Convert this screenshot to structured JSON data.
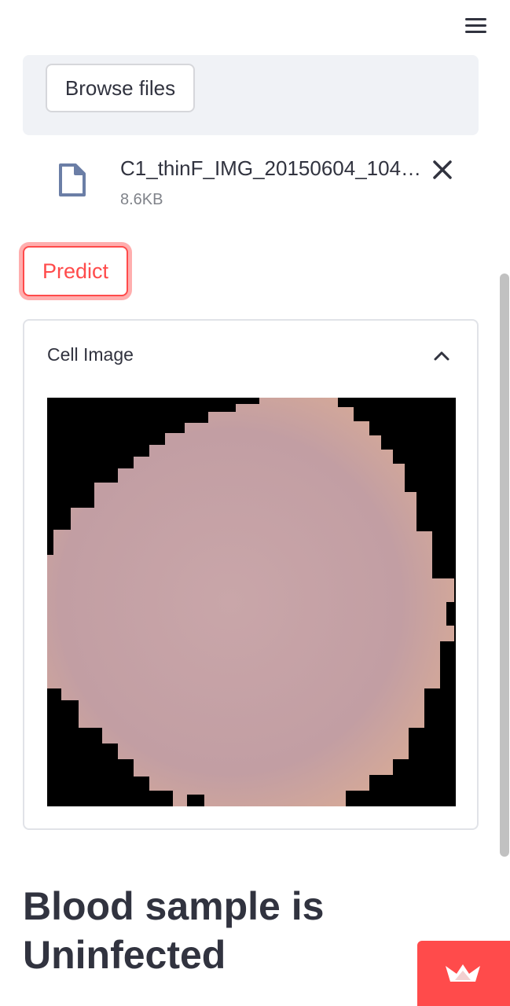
{
  "header": {
    "menu_icon": "hamburger-menu-icon"
  },
  "uploader": {
    "browse_label": "Browse files",
    "file": {
      "icon": "file-icon",
      "name": "C1_thinF_IMG_20150604_104…",
      "size": "8.6KB",
      "delete_icon": "close-icon"
    }
  },
  "predict": {
    "label": "Predict",
    "color": "#ff4b4b"
  },
  "expander": {
    "title": "Cell Image",
    "toggle_icon": "chevron-up-icon",
    "expanded": true,
    "image": {
      "description_icon": "cell-image",
      "background": "#000000",
      "cell_color": "#c8a0a0"
    }
  },
  "result": {
    "text": "Blood sample is Uninfected"
  },
  "badge": {
    "icon": "streamlit-crown-icon",
    "color": "#ff4b4b"
  }
}
